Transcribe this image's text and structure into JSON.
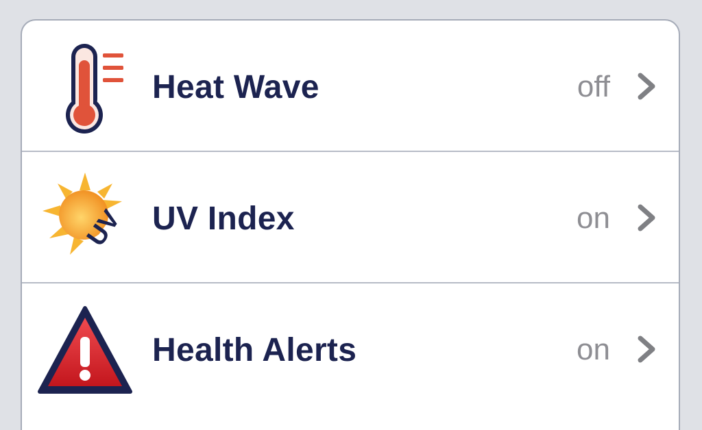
{
  "settings": {
    "rows": [
      {
        "label": "Heat Wave",
        "value": "off",
        "icon": "thermometer-icon"
      },
      {
        "label": "UV Index",
        "value": "on",
        "icon": "uv-sun-icon"
      },
      {
        "label": "Health Alerts",
        "value": "on",
        "icon": "warning-triangle-icon"
      }
    ],
    "colors": {
      "label": "#1c2350",
      "value": "#8e8e93",
      "chevron": "#7f8084",
      "thermometer_red": "#e0533a",
      "sun_orange": "#f5a623",
      "alert_red": "#d8232a"
    }
  }
}
